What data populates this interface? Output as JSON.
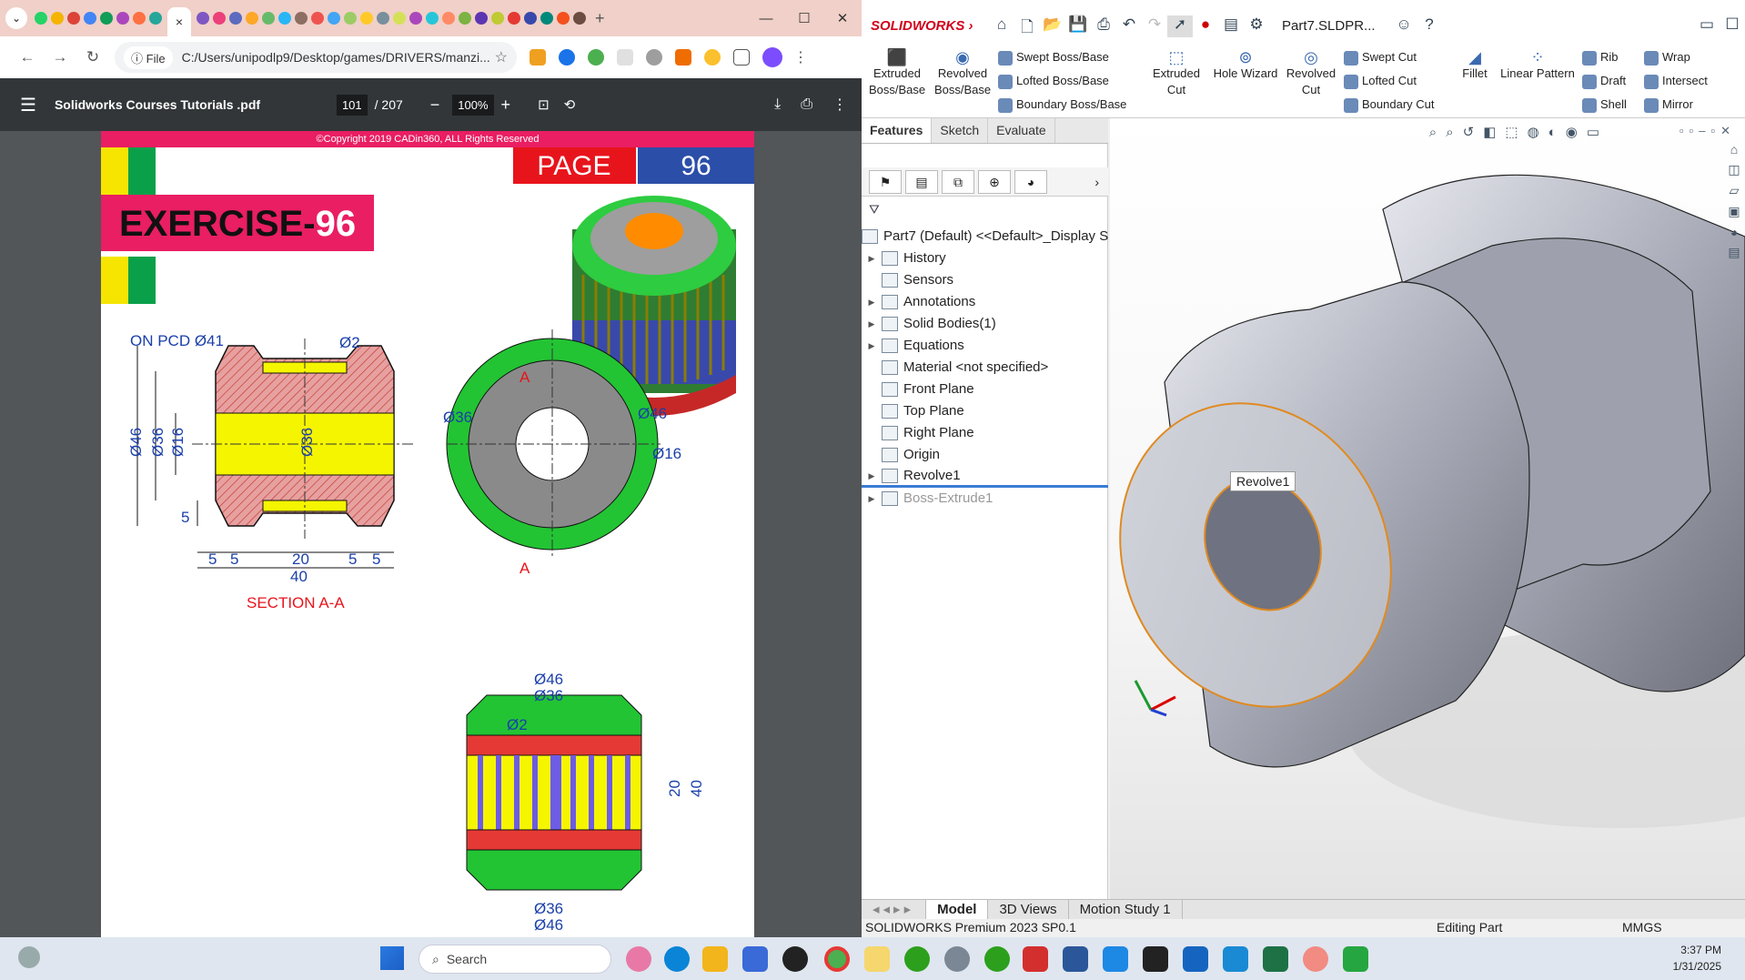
{
  "browser": {
    "active_tab_close": "×",
    "window_controls": [
      "—",
      "☐",
      "✕"
    ],
    "address": "C:/Users/unipodlp9/Desktop/games/DRIVERS/manzi...",
    "file_chip": "File",
    "fav_colors": [
      "#25d366",
      "#f4b400",
      "#db4437",
      "#4285f4",
      "#0f9d58",
      "#ab47bc",
      "#ff7043",
      "#26a69a",
      "#7e57c2",
      "#ec407a",
      "#5c6bc0",
      "#ffa726",
      "#66bb6a",
      "#29b6f6",
      "#8d6e63",
      "#ef5350",
      "#42a5f5",
      "#9ccc65",
      "#ffca28",
      "#78909c",
      "#d4e157",
      "#ab47bc",
      "#26c6da",
      "#ff8a65",
      "#7cb342",
      "#5e35b1",
      "#c0ca33",
      "#e53935",
      "#3949ab",
      "#00897b",
      "#f4511e",
      "#6d4c41"
    ]
  },
  "pdf": {
    "title": "Solidworks Courses Tutorials .pdf",
    "page_current": "101",
    "page_total": "/ 207",
    "zoom": "100%",
    "copyright": "©Copyright 2019 CADin360, ALL Rights Reserved",
    "page_label": "PAGE",
    "page_num": "96",
    "exercise_prefix": "EXERCISE-",
    "exercise_num": "96",
    "section_label": "SECTION A-A",
    "pcd_label": "ON PCD Ø41",
    "dims": {
      "d2": "Ø2",
      "d46": "Ø46",
      "d36": "Ø36",
      "d16": "Ø16",
      "d36c": "Ø36",
      "five": "5",
      "twenty": "20",
      "forty": "40",
      "A": "A"
    }
  },
  "solidworks": {
    "brand": "SOLIDWORKS",
    "doc_title": "Part7.SLDPR...",
    "ribbon": {
      "extruded_boss": "Extruded Boss/Base",
      "revolved_boss": "Revolved Boss/Base",
      "swept_boss": "Swept Boss/Base",
      "lofted_boss": "Lofted Boss/Base",
      "boundary_boss": "Boundary Boss/Base",
      "extruded_cut": "Extruded Cut",
      "hole_wizard": "Hole Wizard",
      "revolved_cut": "Revolved Cut",
      "swept_cut": "Swept Cut",
      "lofted_cut": "Lofted Cut",
      "boundary_cut": "Boundary Cut",
      "fillet": "Fillet",
      "linear_pattern": "Linear Pattern",
      "rib": "Rib",
      "draft": "Draft",
      "shell": "Shell",
      "wrap": "Wrap",
      "intersect": "Intersect",
      "mirror": "Mirror"
    },
    "cm_tabs": [
      "Features",
      "Sketch",
      "Evaluate"
    ],
    "tree": [
      {
        "label": "Part7 (Default) <<Default>_Display S",
        "exp": "",
        "grey": false
      },
      {
        "label": "History",
        "exp": "▶",
        "grey": false
      },
      {
        "label": "Sensors",
        "exp": "",
        "grey": false
      },
      {
        "label": "Annotations",
        "exp": "▶",
        "grey": false
      },
      {
        "label": "Solid Bodies(1)",
        "exp": "▶",
        "grey": false
      },
      {
        "label": "Equations",
        "exp": "▶",
        "grey": false
      },
      {
        "label": "Material <not specified>",
        "exp": "",
        "grey": false
      },
      {
        "label": "Front Plane",
        "exp": "",
        "grey": false
      },
      {
        "label": "Top Plane",
        "exp": "",
        "grey": false
      },
      {
        "label": "Right Plane",
        "exp": "",
        "grey": false
      },
      {
        "label": "Origin",
        "exp": "",
        "grey": false
      },
      {
        "label": "Revolve1",
        "exp": "▶",
        "grey": false
      },
      {
        "label": "Boss-Extrude1",
        "exp": "▶",
        "grey": true
      }
    ],
    "tooltip": "Revolve1",
    "bottom_tabs": [
      "Model",
      "3D Views",
      "Motion Study 1"
    ],
    "status_left": "SOLIDWORKS Premium 2023 SP0.1",
    "status_mid": "Editing Part",
    "status_units": "MMGS"
  },
  "taskbar": {
    "search_placeholder": "Search",
    "time": "3:37 PM",
    "date": "1/31/2025"
  }
}
